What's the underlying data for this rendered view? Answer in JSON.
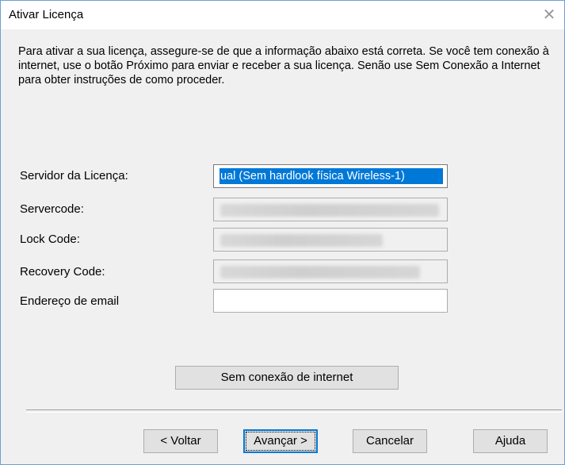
{
  "window": {
    "title": "Ativar Licença",
    "close_glyph": "✕"
  },
  "intro_text": "Para ativar a sua licença, assegure-se de que a informação abaixo está correta. Se você tem conexão à internet, use o botão Próximo para enviar e receber a sua licença. Senão use Sem Conexão a Internet para obter instruções de como proceder.",
  "form": {
    "server_label": "Servidor da Licença:",
    "server_value": "ual (Sem hardlook física Wireless-1)",
    "servercode_label": "Servercode:",
    "servercode_value": "",
    "lockcode_label": "Lock Code:",
    "lockcode_value": "",
    "recovery_label": "Recovery Code:",
    "recovery_value": "",
    "email_label": "Endereço de email",
    "email_value": ""
  },
  "buttons": {
    "offline": "Sem conexão de internet",
    "back": "< Voltar",
    "next": "Avançar >",
    "cancel": "Cancelar",
    "help": "Ajuda"
  },
  "colors": {
    "accent": "#0078d7",
    "dialog_bg": "#f0f0f0",
    "border": "#6d9fd6"
  }
}
